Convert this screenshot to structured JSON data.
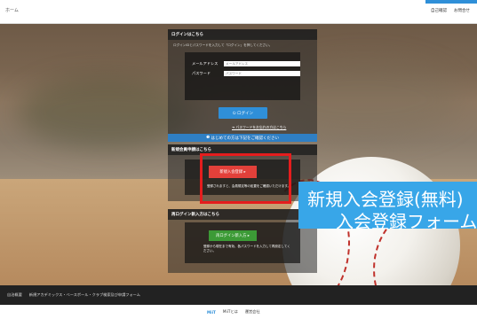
{
  "header": {
    "logo_text": "ホーム",
    "links": [
      "自己確認",
      "お問合せ"
    ]
  },
  "login": {
    "title": "ログインはこちら",
    "note": "ログインIDとパスワードを入力して「ログイン」を押してください。",
    "email_label": "メールアドレス",
    "email_placeholder": "メールアドレス",
    "password_label": "パスワード",
    "password_placeholder": "パスワード",
    "login_button": "ログイン",
    "forgot_link": "パスワードをお忘れの方はこちら"
  },
  "notice": "はじめての方は下記をご確認ください",
  "registration": {
    "title": "新規会員申請はこちら",
    "button": "新規入会登録",
    "note": "登録されますと、会員規定等の処置をご確認いただけます。"
  },
  "relogin": {
    "title": "再ログイン新入方はこちら",
    "button": "再ログイン新入方",
    "note": "登録から現在まで有効、各パスワードを入力して再設定してください。"
  },
  "banner": {
    "line1": "新規入会登録(無料)",
    "line2": "入会登録フォーム"
  },
  "footer": {
    "links": [
      "自治概要",
      "新規アカデミックス・ベースボール・クラブ検索及び申請フォーム"
    ]
  },
  "bottom": {
    "brand": "MiiT",
    "links": [
      "MiiTとは",
      "運営会社"
    ]
  }
}
